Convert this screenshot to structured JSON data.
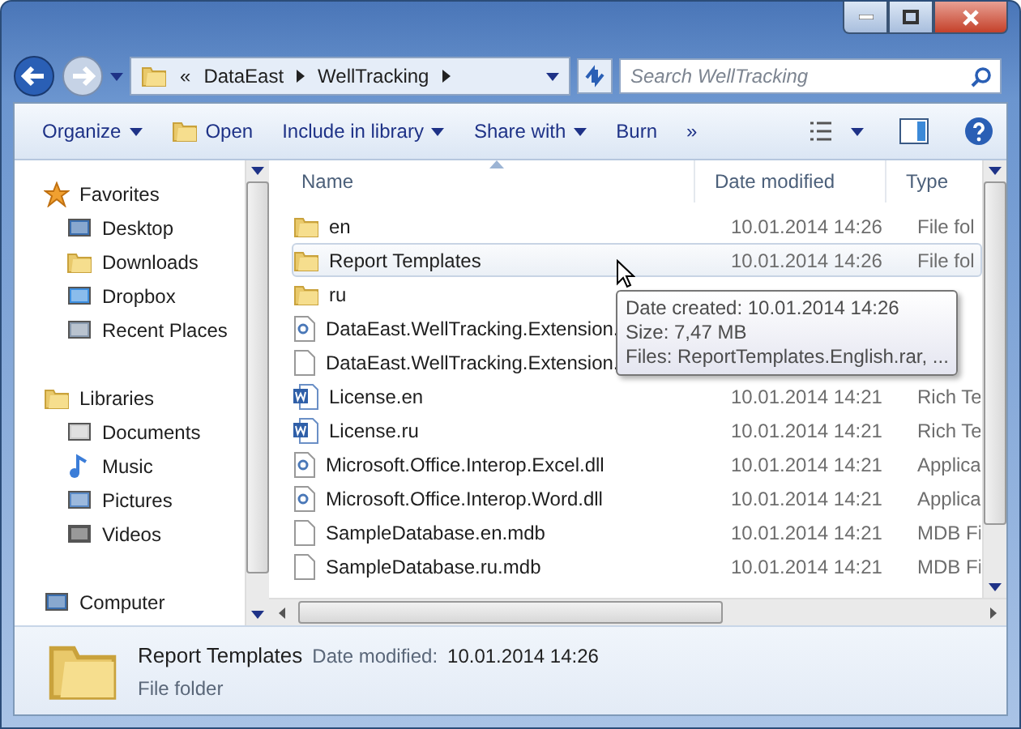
{
  "address": {
    "segments": [
      "«",
      "DataEast",
      "WellTracking"
    ]
  },
  "search": {
    "placeholder": "Search WellTracking"
  },
  "toolbar": [
    {
      "label": "Organize",
      "dropdown": true,
      "kind": "text"
    },
    {
      "label": "Open",
      "dropdown": false,
      "kind": "open"
    },
    {
      "label": "Include in library",
      "dropdown": true,
      "kind": "text"
    },
    {
      "label": "Share with",
      "dropdown": true,
      "kind": "text"
    },
    {
      "label": "Burn",
      "dropdown": false,
      "kind": "text"
    },
    {
      "label": "»",
      "dropdown": false,
      "kind": "text"
    }
  ],
  "sidebar": {
    "groups": [
      {
        "label": "Favorites",
        "kind": "star",
        "children": [
          {
            "label": "Desktop",
            "kind": "desktop"
          },
          {
            "label": "Downloads",
            "kind": "downloads"
          },
          {
            "label": "Dropbox",
            "kind": "dropbox"
          },
          {
            "label": "Recent Places",
            "kind": "recent"
          }
        ]
      },
      {
        "label": "Libraries",
        "kind": "library",
        "children": [
          {
            "label": "Documents",
            "kind": "documents"
          },
          {
            "label": "Music",
            "kind": "music"
          },
          {
            "label": "Pictures",
            "kind": "pictures"
          },
          {
            "label": "Videos",
            "kind": "videos"
          }
        ]
      },
      {
        "label": "Computer",
        "kind": "computer"
      }
    ]
  },
  "table": {
    "columns": [
      {
        "label": "Name",
        "sorted": true
      },
      {
        "label": "Date modified",
        "sorted": false
      },
      {
        "label": "Type",
        "sorted": false
      }
    ],
    "rows": [
      {
        "name": "en",
        "date": "10.01.2014 14:26",
        "type": "File fol",
        "kind": "folder",
        "selected": false
      },
      {
        "name": "Report Templates",
        "date": "10.01.2014 14:26",
        "type": "File fol",
        "kind": "folder",
        "selected": true
      },
      {
        "name": "ru",
        "kind": "folder",
        "selected": false
      },
      {
        "name": "DataEast.WellTracking.Extension.",
        "kind": "dll",
        "selected": false
      },
      {
        "name": "DataEast.WellTracking.Extension.",
        "kind": "file",
        "selected": false
      },
      {
        "name": "License.en",
        "date": "10.01.2014 14:21",
        "type": "Rich Te",
        "kind": "word",
        "selected": false
      },
      {
        "name": "License.ru",
        "date": "10.01.2014 14:21",
        "type": "Rich Te",
        "kind": "word",
        "selected": false
      },
      {
        "name": "Microsoft.Office.Interop.Excel.dll",
        "date": "10.01.2014 14:21",
        "type": "Applica",
        "kind": "dll",
        "selected": false
      },
      {
        "name": "Microsoft.Office.Interop.Word.dll",
        "date": "10.01.2014 14:21",
        "type": "Applica",
        "kind": "dll",
        "selected": false
      },
      {
        "name": "SampleDatabase.en.mdb",
        "date": "10.01.2014 14:21",
        "type": "MDB Fi",
        "kind": "file",
        "selected": false
      },
      {
        "name": "SampleDatabase.ru.mdb",
        "date": "10.01.2014 14:21",
        "type": "MDB Fi",
        "kind": "file",
        "selected": false
      }
    ]
  },
  "tooltip": [
    "Date created: 10.01.2014 14:26",
    "Size: 7,47 MB",
    "Files: ReportTemplates.English.rar, ..."
  ],
  "details": {
    "name": "Report Templates",
    "date_label": "Date modified:",
    "date": "10.01.2014 14:26",
    "type": "File folder"
  }
}
